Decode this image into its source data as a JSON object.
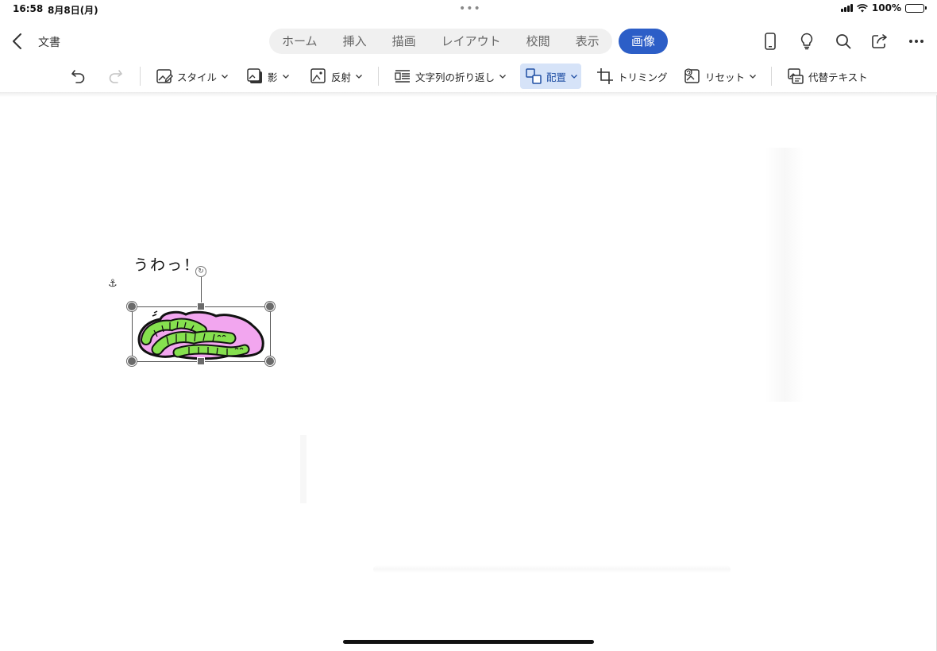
{
  "status_bar": {
    "time": "16:58",
    "date": "8月8日(月)",
    "battery": "100%"
  },
  "header": {
    "document_title": "文書",
    "tabs": [
      {
        "label": "ホーム"
      },
      {
        "label": "挿入"
      },
      {
        "label": "描画"
      },
      {
        "label": "レイアウト"
      },
      {
        "label": "校閲"
      },
      {
        "label": "表示"
      }
    ],
    "active_tab": "画像",
    "accent_color": "#2c5ec7"
  },
  "ribbon": {
    "style_label": "スタイル",
    "shadow_label": "影",
    "reflection_label": "反射",
    "wrap_label": "文字列の折り返し",
    "arrange_label": "配置",
    "crop_label": "トリミング",
    "reset_label": "リセット",
    "alt_text_label": "代替テキスト"
  },
  "document": {
    "text": "うわっ！",
    "selected_picture": "caterpillars-illustration"
  }
}
